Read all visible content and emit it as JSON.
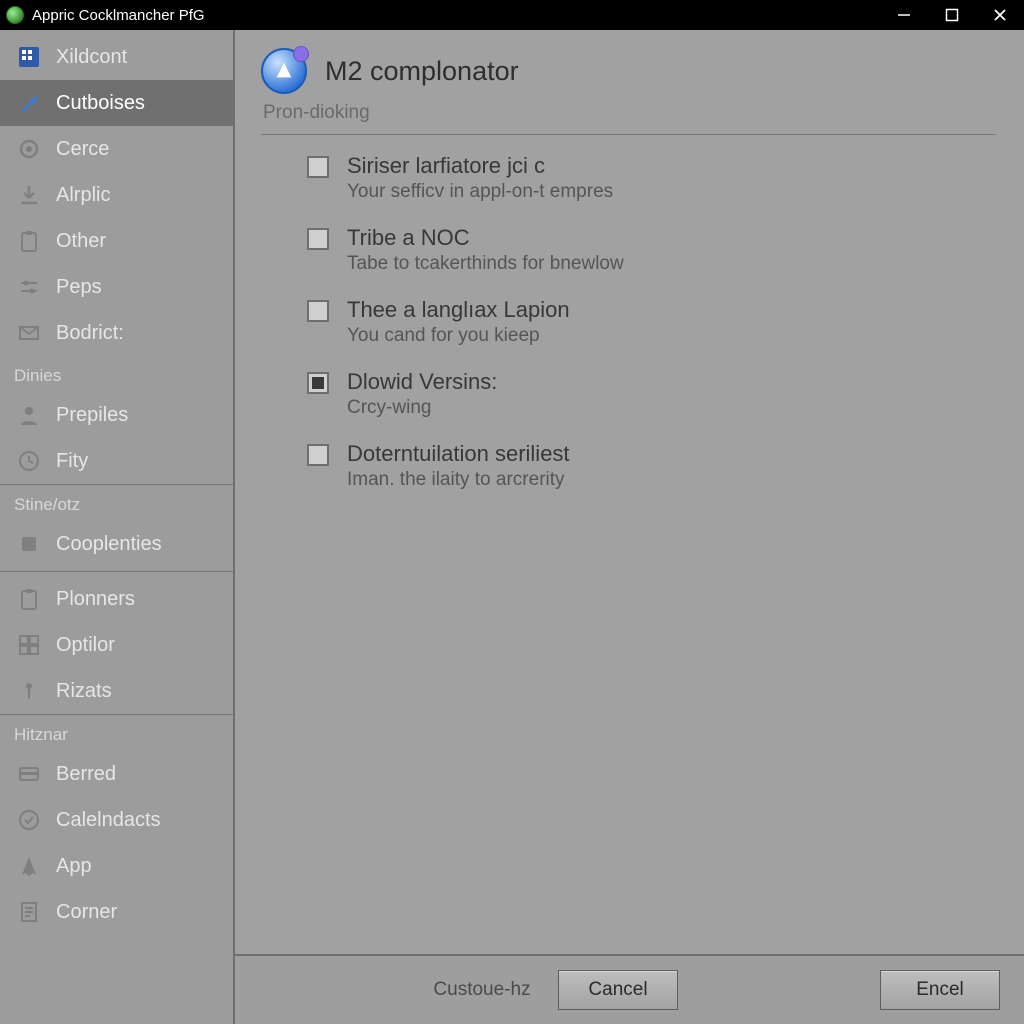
{
  "window": {
    "title": "Appric Cocklmancher PfG"
  },
  "sidebar": {
    "group1": [
      {
        "label": "Xildcont",
        "icon": "grid-icon",
        "selected": false
      },
      {
        "label": "Cutboises",
        "icon": "wrench-icon",
        "selected": true
      },
      {
        "label": "Cerce",
        "icon": "gear-icon",
        "selected": false
      },
      {
        "label": "Alrplic",
        "icon": "download-icon",
        "selected": false
      },
      {
        "label": "Other",
        "icon": "clipboard-icon",
        "selected": false
      },
      {
        "label": "Peps",
        "icon": "sliders-icon",
        "selected": false
      },
      {
        "label": "Bodrict:",
        "icon": "mail-icon",
        "selected": false
      }
    ],
    "header1": "Dinies",
    "group2": [
      {
        "label": "Prepiles",
        "icon": "person-icon"
      },
      {
        "label": "Fity",
        "icon": "clock-icon"
      }
    ],
    "header2": "Stine/otz",
    "group3": [
      {
        "label": "Cooplenties",
        "icon": "square-icon"
      }
    ],
    "group4": [
      {
        "label": "Plonners",
        "icon": "clipboard-icon"
      },
      {
        "label": "Optilor",
        "icon": "grid2-icon"
      },
      {
        "label": "Rizats",
        "icon": "pin-icon"
      }
    ],
    "header3": "Hitznar",
    "group5": [
      {
        "label": "Berred",
        "icon": "card-icon"
      },
      {
        "label": "Calelndacts",
        "icon": "check-circle-icon"
      },
      {
        "label": "App",
        "icon": "pointer-icon"
      },
      {
        "label": "Corner",
        "icon": "sheet-icon"
      }
    ]
  },
  "page": {
    "title": "M2 complonator",
    "subtitle": "Pron-dioking",
    "options": [
      {
        "title": "Siriser larfiatore jci c",
        "desc": "Your sefficv in appl-on-t empres",
        "checked": false
      },
      {
        "title": "Tribe a NOC",
        "desc": "Tabe to tcakerthinds for bnewlow",
        "checked": false
      },
      {
        "title": "Thee a langlıax Lapion",
        "desc": "You cand for you kieep",
        "checked": false
      },
      {
        "title": "Dlowid Versins:",
        "desc": "Crcy-wing",
        "checked": true
      },
      {
        "title": "Doterntuilation seriliest",
        "desc": "Iman. the ilaity to arcrerity",
        "checked": false
      }
    ]
  },
  "footer": {
    "customize": "Custoue-hz",
    "cancel": "Cancel",
    "ok": "Encel"
  },
  "colors": {
    "accent": "#2a6fd6",
    "sidebar_selected": "#707070"
  }
}
